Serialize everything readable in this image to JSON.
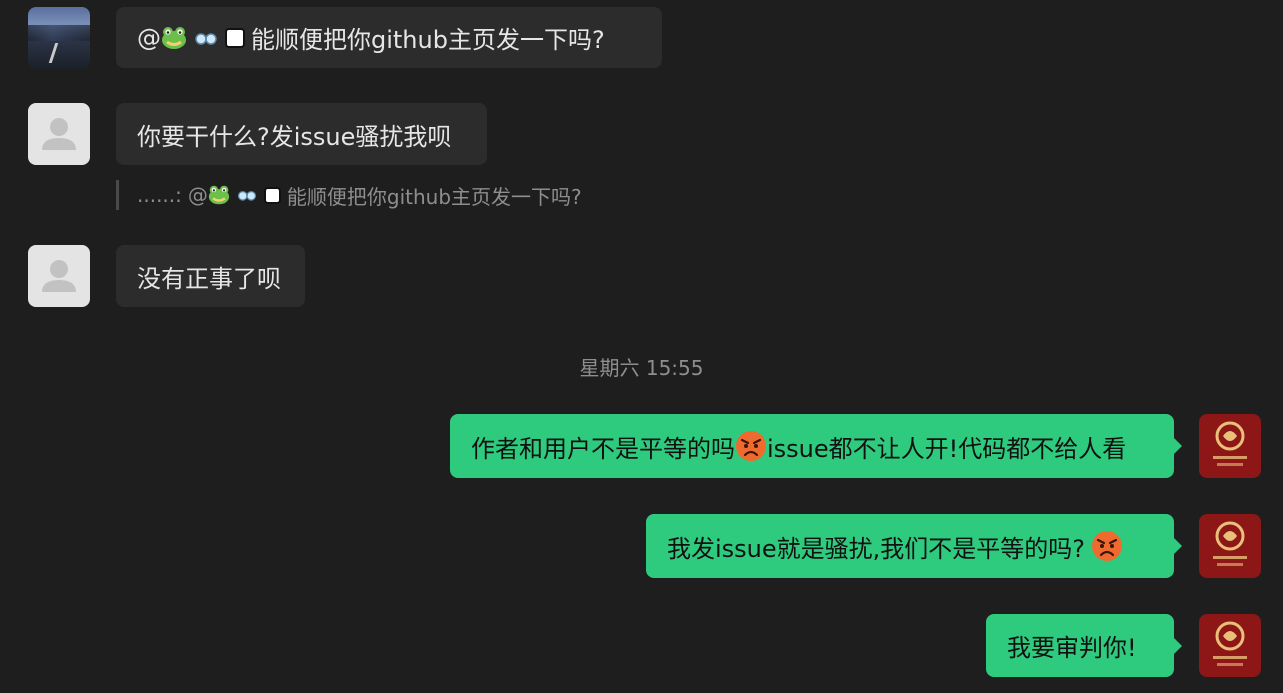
{
  "messages": [
    {
      "side": "left",
      "avatar": "road-photo-avatar",
      "prefix": "@",
      "icons": [
        "frog-icon",
        "glasses-icon",
        "white-square-icon"
      ],
      "text": "能顺便把你github主页发一下吗?"
    },
    {
      "side": "left",
      "avatar": "default-avatar",
      "text": "你要干什么?发issue骚扰我呗"
    },
    {
      "side": "left",
      "avatar": "default-avatar",
      "text": "没有正事了呗"
    },
    {
      "side": "right",
      "avatar": "gala-avatar",
      "text_before": "作者和用户不是平等的吗",
      "icon": "angry-face-icon",
      "text_after": "issue都不让人开!代码都不给人看"
    },
    {
      "side": "right",
      "avatar": "gala-avatar",
      "text": "我发issue就是骚扰,我们不是平等的吗?",
      "icon": "angry-face-icon"
    },
    {
      "side": "right",
      "avatar": "gala-avatar",
      "text": "我要审判你!"
    }
  ],
  "quote": {
    "sender": "......:",
    "prefix": "@",
    "icons": [
      "frog-icon",
      "glasses-icon",
      "white-square-icon"
    ],
    "text": "能顺便把你github主页发一下吗?"
  },
  "timestamp": "星期六 15:55",
  "colors": {
    "background": "#1e1e1e",
    "incoming_bubble": "#2c2c2c",
    "outgoing_bubble": "#2ecb7f",
    "muted_text": "#8e8e8e"
  }
}
